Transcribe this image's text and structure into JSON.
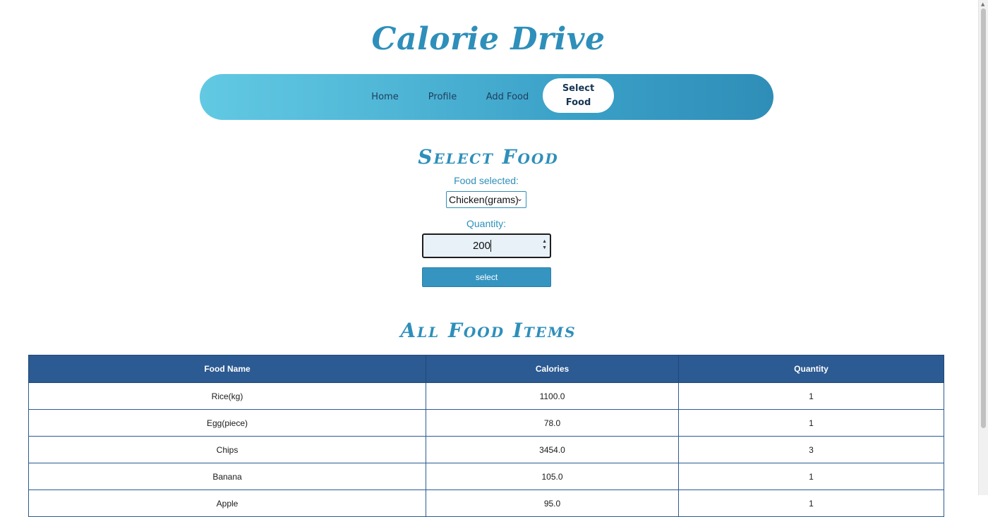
{
  "app": {
    "title": "Calorie Drive"
  },
  "nav": {
    "items": [
      {
        "label": "Home"
      },
      {
        "label": "Profile"
      },
      {
        "label": "Add Food"
      },
      {
        "label": "Select Food"
      }
    ]
  },
  "select_section": {
    "title": "Select Food",
    "food_label": "Food selected:",
    "food_value": "Chicken(grams)",
    "quantity_label": "Quantity:",
    "quantity_value": "200",
    "button_label": "select"
  },
  "table_section": {
    "title": "All Food Items",
    "columns": [
      "Food Name",
      "Calories",
      "Quantity"
    ],
    "rows": [
      {
        "name": "Rice(kg)",
        "calories": "1100.0",
        "quantity": "1"
      },
      {
        "name": "Egg(piece)",
        "calories": "78.0",
        "quantity": "1"
      },
      {
        "name": "Chips",
        "calories": "3454.0",
        "quantity": "3"
      },
      {
        "name": "Banana",
        "calories": "105.0",
        "quantity": "1"
      },
      {
        "name": "Apple",
        "calories": "95.0",
        "quantity": "1"
      }
    ]
  },
  "colors": {
    "accent": "#2e8fba",
    "table_header": "#2c5a92",
    "nav_gradient_start": "#62c9e3",
    "nav_gradient_end": "#2f8eb7"
  }
}
